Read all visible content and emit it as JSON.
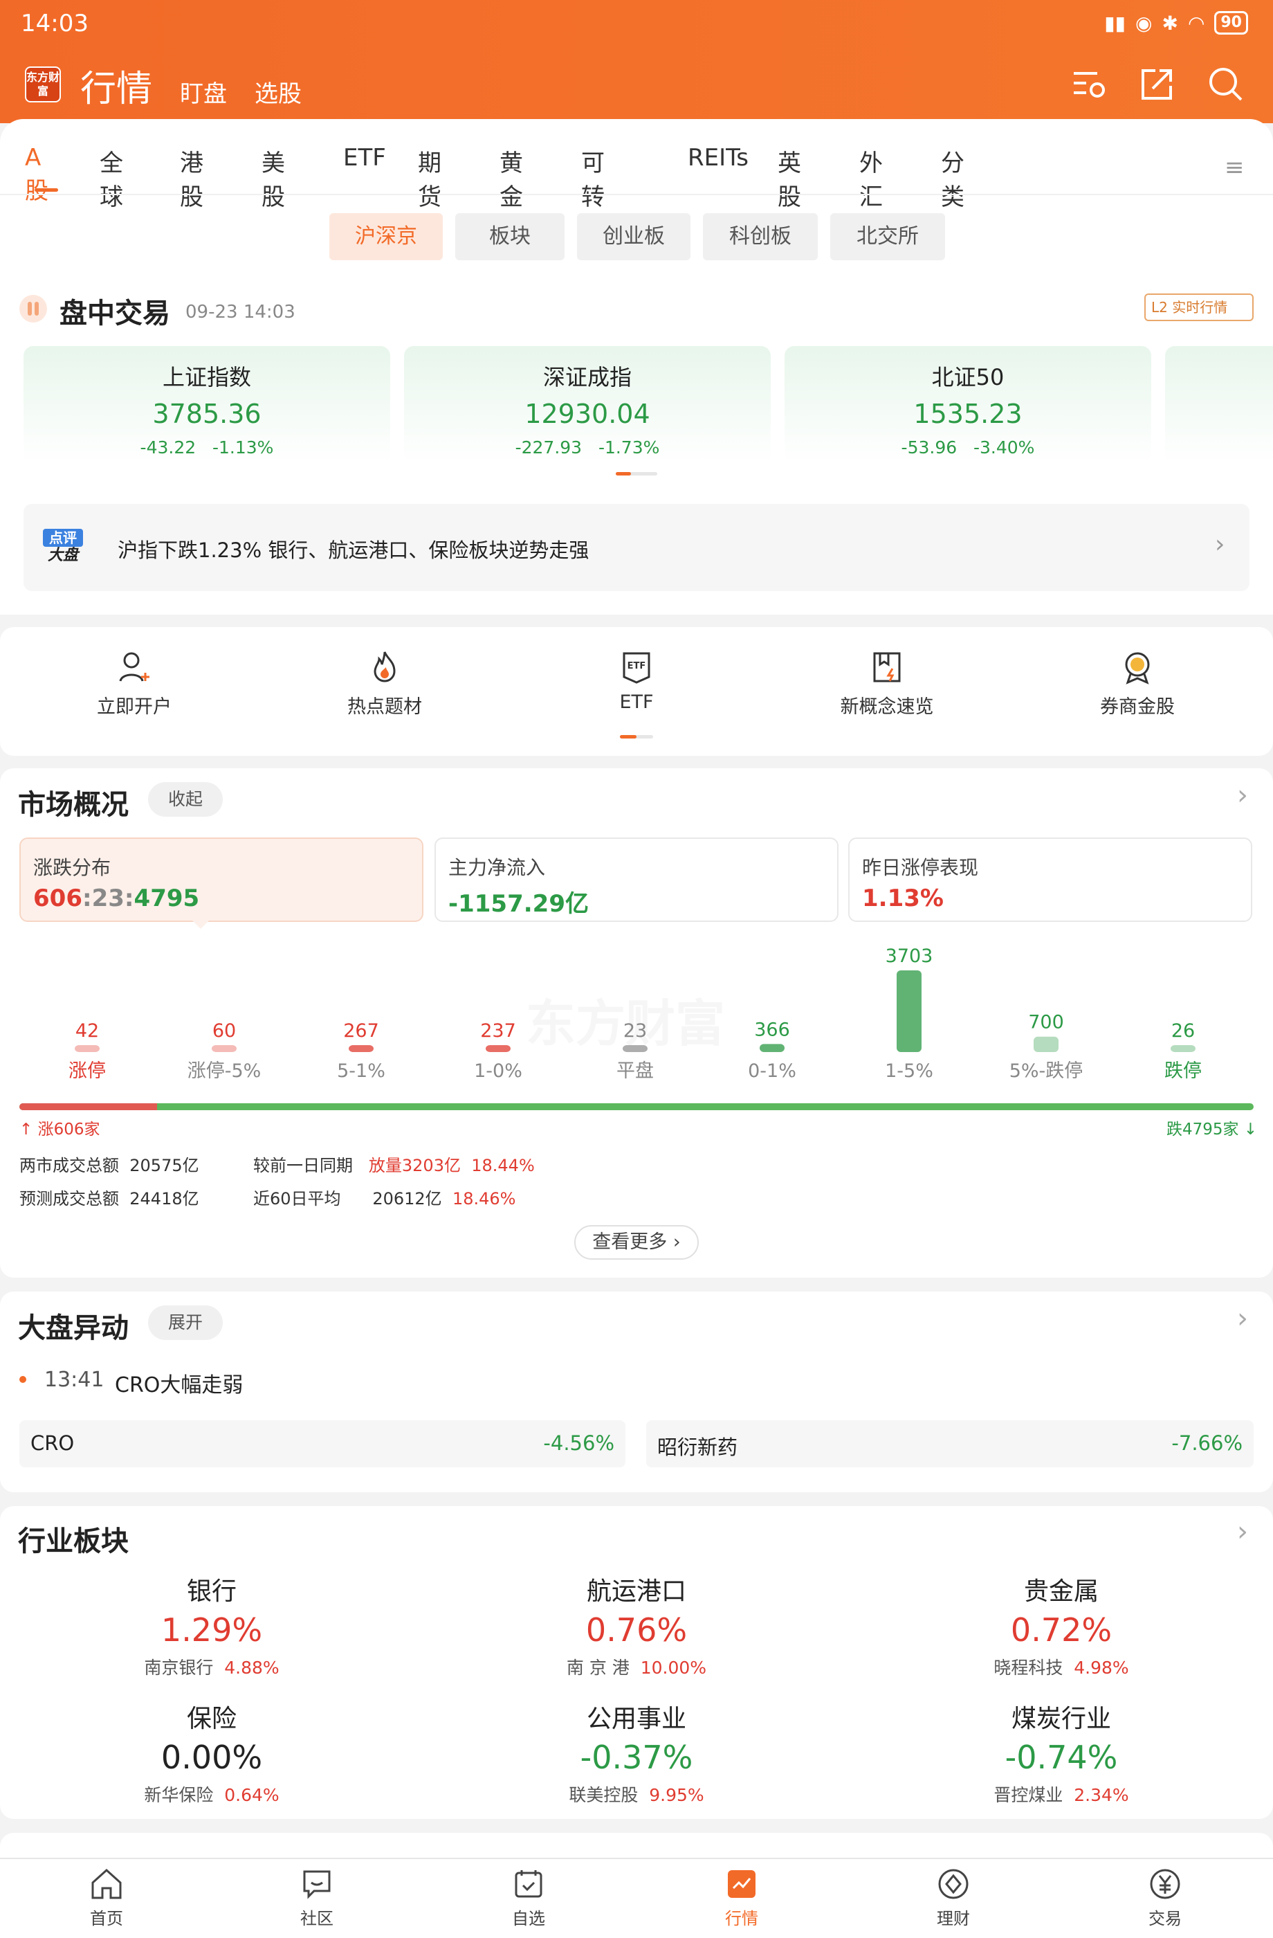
{
  "status": {
    "time": "14:03",
    "battery": "90"
  },
  "header": {
    "logo": "东方财富",
    "title": "行情",
    "nav": [
      "盯盘",
      "选股"
    ]
  },
  "tabs": [
    "A股",
    "全球",
    "港股",
    "美股",
    "ETF",
    "期货",
    "黄金",
    "可转债",
    "REITs",
    "英股",
    "外汇",
    "分类"
  ],
  "subtabs": [
    "沪深京",
    "板块",
    "创业板",
    "科创板",
    "北交所"
  ],
  "trading": {
    "title": "盘中交易",
    "date": "09-23 14:03",
    "l2_badge": "L2 实时行情"
  },
  "indices": [
    {
      "name": "上证指数",
      "value": "3785.36",
      "change": "-43.22",
      "pct": "-1.13%"
    },
    {
      "name": "深证成指",
      "value": "12930.04",
      "change": "-227.93",
      "pct": "-1.73%"
    },
    {
      "name": "北证50",
      "value": "1535.23",
      "change": "-53.96",
      "pct": "-3.40%"
    }
  ],
  "comment": {
    "badge_top": "点评",
    "badge_bottom": "大盘",
    "text": "沪指下跌1.23% 银行、航运港口、保险板块逆势走强"
  },
  "quick": [
    "立即开户",
    "热点题材",
    "ETF",
    "新概念速览",
    "券商金股"
  ],
  "market": {
    "title": "市场概况",
    "collapse": "收起",
    "cards": [
      {
        "label": "涨跌分布",
        "value_up": "606",
        "value_flat": "23",
        "value_down": "4795"
      },
      {
        "label": "主力净流入",
        "value": "-1157.29亿"
      },
      {
        "label": "昨日涨停表现",
        "value": "1.13%"
      }
    ],
    "watermark": "东方财富",
    "dist_labels": [
      "涨停",
      "涨停-5%",
      "5-1%",
      "1-0%",
      "平盘",
      "0-1%",
      "1-5%",
      "5%-跌停",
      "跌停"
    ],
    "up_count": "涨606家",
    "down_count": "跌4795家",
    "stats": {
      "total_label": "两市成交总额",
      "total": "20575亿",
      "cmp_label": "较前一日同期",
      "cmp_value": "放量3203亿",
      "cmp_pct": "18.44%",
      "pred_label": "预测成交总额",
      "pred": "24418亿",
      "avg_label": "近60日平均",
      "avg": "20612亿",
      "avg_pct": "18.46%"
    },
    "more": "查看更多"
  },
  "chart_data": {
    "type": "bar",
    "categories": [
      "涨停",
      "涨停-5%",
      "5-1%",
      "1-0%",
      "平盘",
      "0-1%",
      "1-5%",
      "5%-跌停",
      "跌停"
    ],
    "values": [
      42,
      60,
      267,
      237,
      23,
      366,
      3703,
      700,
      26
    ],
    "colors": [
      "#e03c31",
      "#e03c31",
      "#e03c31",
      "#e03c31",
      "#888888",
      "#2c9a46",
      "#2c9a46",
      "#2c9a46",
      "#2c9a46"
    ]
  },
  "anomaly": {
    "title": "大盘异动",
    "expand": "展开",
    "time": "13:41",
    "event": "CRO大幅走弱",
    "stocks": [
      {
        "name": "CRO",
        "pct": "-4.56%"
      },
      {
        "name": "昭衍新药",
        "pct": "-7.66%"
      }
    ]
  },
  "industry": {
    "title": "行业板块",
    "items": [
      {
        "name": "银行",
        "pct": "1.29%",
        "lead": "南京银行",
        "lead_pct": "4.88%",
        "dir": "up"
      },
      {
        "name": "航运港口",
        "pct": "0.76%",
        "lead": "南 京 港",
        "lead_pct": "10.00%",
        "dir": "up"
      },
      {
        "name": "贵金属",
        "pct": "0.72%",
        "lead": "晓程科技",
        "lead_pct": "4.98%",
        "dir": "up"
      },
      {
        "name": "保险",
        "pct": "0.00%",
        "lead": "新华保险",
        "lead_pct": "0.64%",
        "dir": "flat"
      },
      {
        "name": "公用事业",
        "pct": "-0.37%",
        "lead": "联美控股",
        "lead_pct": "9.95%",
        "dir": "down"
      },
      {
        "name": "煤炭行业",
        "pct": "-0.74%",
        "lead": "晋控煤业",
        "lead_pct": "2.34%",
        "dir": "down"
      }
    ]
  },
  "bottom_nav": [
    "首页",
    "社区",
    "自选",
    "行情",
    "理财",
    "交易"
  ]
}
